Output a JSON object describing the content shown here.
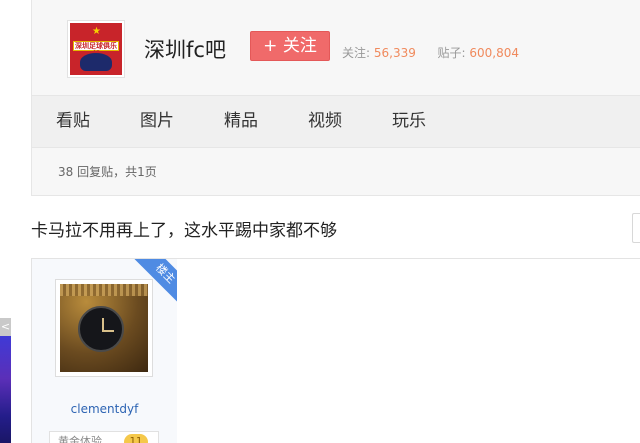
{
  "forum": {
    "name": "深圳fc吧",
    "follow_label": "+ 关注",
    "followers_label": "关注:",
    "followers_count": "56,339",
    "posts_label": "贴子:",
    "posts_count": "600,804",
    "logo_text": "深圳足球俱乐部"
  },
  "tabs": [
    {
      "label": "看贴"
    },
    {
      "label": "图片"
    },
    {
      "label": "精品"
    },
    {
      "label": "视频"
    },
    {
      "label": "玩乐"
    }
  ],
  "thread": {
    "info": "38 回复贴，共1页",
    "title": "卡马拉不用再上了，这水平踢中家都不够"
  },
  "post": {
    "badge": "楼主",
    "author": "clementdyf",
    "level_text": "黄金体验",
    "level": "11"
  },
  "colors": {
    "follow_button": "#f06a6a",
    "stat_numbers": "#f08a5d",
    "author_link": "#2d64b3",
    "badge": "#4f8be3"
  }
}
